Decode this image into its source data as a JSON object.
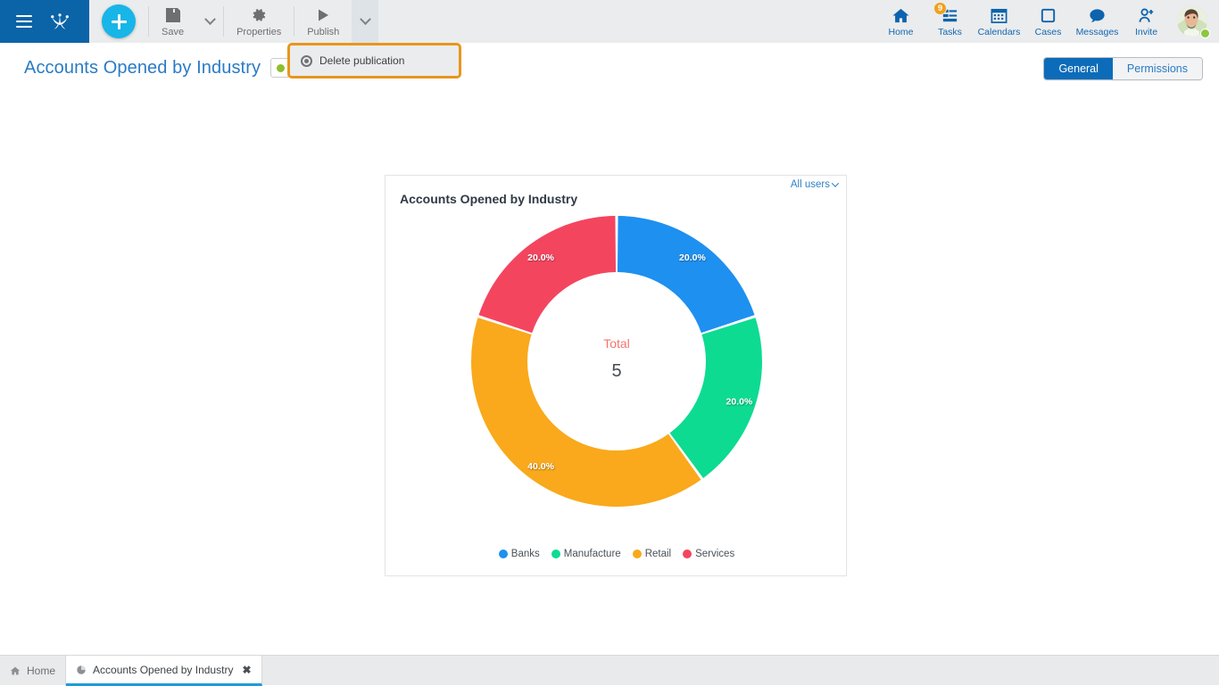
{
  "topbar": {
    "menu_icon": "hamburger-icon",
    "logo_icon": "crow-foot-logo-icon",
    "add_button_label": "+",
    "tools": [
      {
        "label": "Save",
        "icon": "floppy-disk-icon",
        "has_caret": true,
        "caret_active": false
      },
      {
        "label": "Properties",
        "icon": "gear-icon",
        "has_caret": false,
        "caret_active": false
      },
      {
        "label": "Publish",
        "icon": "play-triangle-icon",
        "has_caret": true,
        "caret_active": true
      }
    ],
    "nav": [
      {
        "label": "Home",
        "icon": "home-icon",
        "badge": ""
      },
      {
        "label": "Tasks",
        "icon": "tasks-list-icon",
        "badge": "9"
      },
      {
        "label": "Calendars",
        "icon": "calendar-icon",
        "badge": ""
      },
      {
        "label": "Cases",
        "icon": "square-outline-icon",
        "badge": ""
      },
      {
        "label": "Messages",
        "icon": "speech-bubble-icon",
        "badge": ""
      },
      {
        "label": "Invite",
        "icon": "person-add-icon",
        "badge": ""
      }
    ],
    "avatar": {
      "name": "user-avatar",
      "status": "online"
    }
  },
  "pagehead": {
    "title": "Accounts Opened by Industry",
    "status_dot_color": "#8fbe2a",
    "tabs": [
      {
        "label": "General",
        "selected": true
      },
      {
        "label": "Permissions",
        "selected": false
      }
    ]
  },
  "dropdown": {
    "visible": true,
    "items": [
      {
        "label": "Delete publication",
        "icon": "target-circle-icon"
      }
    ],
    "highlight_color": "#e8961e"
  },
  "card": {
    "title": "Accounts Opened by Industry",
    "users_filter": "All users",
    "center_label": "Total",
    "center_value": "5"
  },
  "chart_data": {
    "type": "pie",
    "variant": "donut",
    "title": "Accounts Opened by Industry",
    "categories": [
      "Banks",
      "Manufacture",
      "Retail",
      "Services"
    ],
    "values": [
      1,
      1,
      2,
      1
    ],
    "percentages": [
      "20.0%",
      "20.0%",
      "40.0%",
      "20.0%"
    ],
    "colors": [
      "#1e90f0",
      "#0ddb92",
      "#f9a91b",
      "#f4455f"
    ],
    "total_label": "Total",
    "total_value": "5",
    "start_angle_deg": 0,
    "legend_position": "bottom",
    "data_labels": true,
    "data_label_color": "#ffffff"
  },
  "taskbar": {
    "tabs": [
      {
        "label": "Home",
        "icon": "home-icon",
        "active": false,
        "closable": false
      },
      {
        "label": "Accounts Opened by Industry",
        "icon": "pie-chart-icon",
        "active": true,
        "closable": true,
        "close_glyph": "✖"
      }
    ]
  }
}
